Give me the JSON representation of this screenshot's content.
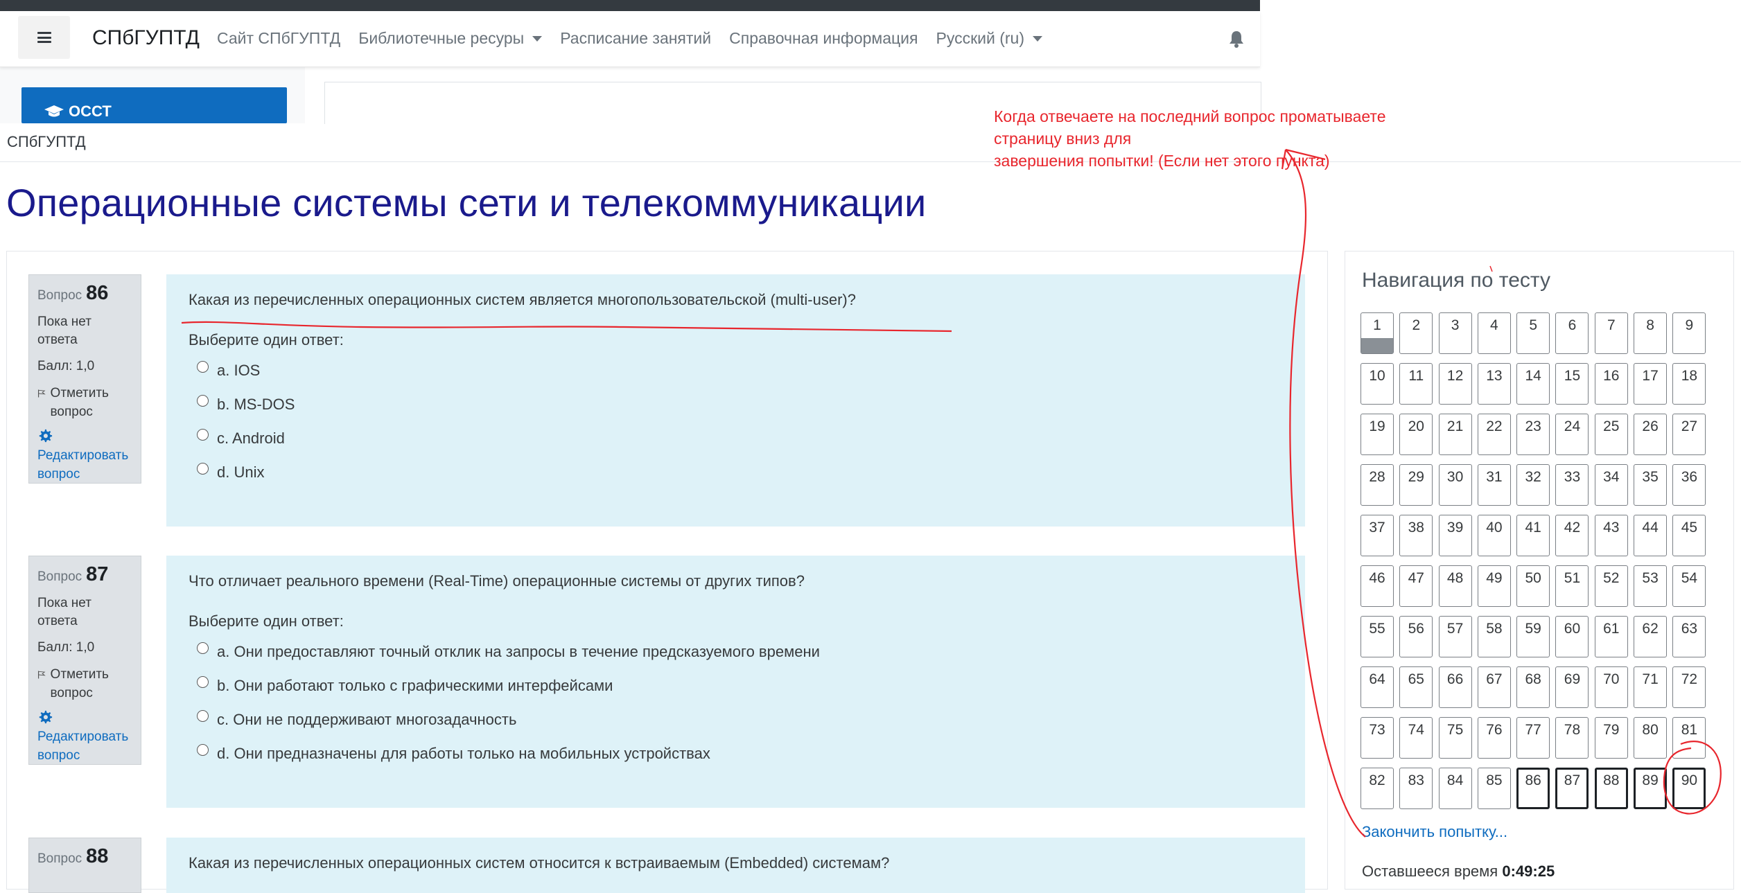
{
  "navbar": {
    "brand": "СПбГУПТД",
    "links": [
      "Сайт СПбГУПТД",
      "Библиотечные ресуры",
      "Расписание занятий",
      "Справочная информация",
      "Русский (ru)"
    ],
    "dropdown_indexes": [
      1,
      4
    ]
  },
  "sidebar": {
    "block_label": "ОССТ"
  },
  "breadcrumb": "СПбГУПТД",
  "page_title": "Операционные системы сети и телекоммуникации",
  "annotation": {
    "line1": "Когда отвечаете на последний вопрос проматываете страницу вниз для",
    "line2": "завершения попытки!  (Если нет этого пункта)"
  },
  "labels": {
    "question_word": "Вопрос",
    "flag": "Отметить вопрос",
    "edit": "Редактировать вопрос",
    "prompt": "Выберите один ответ:"
  },
  "questions": [
    {
      "number": "86",
      "state": "Пока нет ответа",
      "grade": "Балл: 1,0",
      "text": "Какая из перечисленных операционных систем является многопользовательской (multi-user)?",
      "answers": [
        "a. IOS",
        "b. MS-DOS",
        "c. Android",
        "d. Unix"
      ]
    },
    {
      "number": "87",
      "state": "Пока нет ответа",
      "grade": "Балл: 1,0",
      "text": "Что отличает реального времени (Real-Time) операционные системы от других типов?",
      "answers": [
        "a. Они предоставляют точный отклик на запросы в течение предсказуемого времени",
        "b. Они работают только с графическими интерфейсами",
        "c. Они не поддерживают многозадачность",
        "d. Они предназначены для работы только на мобильных устройствах"
      ]
    },
    {
      "number": "88",
      "text": "Какая из перечисленных операционных систем относится к встраиваемым (Embedded) системам?"
    }
  ],
  "quiz_nav": {
    "title": "Навигация по тесту",
    "total": 90,
    "current": 1,
    "thick_border": [
      86,
      87,
      88,
      89,
      90
    ],
    "finish_link": "Закончить попытку...",
    "time_label": "Оставшееся время",
    "time_value": "0:49:25"
  },
  "colors": {
    "accent": "#0f6cbf",
    "title": "#1a1a8c",
    "question_bg": "#def2f8",
    "info_bg": "#dee2e6",
    "annotation": "#e8262d"
  }
}
